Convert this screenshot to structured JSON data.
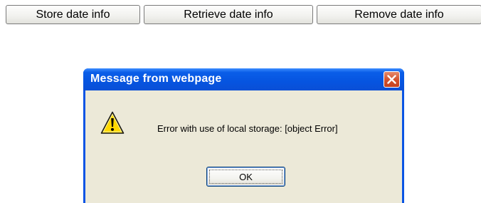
{
  "toolbar": {
    "store_label": "Store date info",
    "retrieve_label": "Retrieve date info",
    "remove_label": "Remove date info"
  },
  "dialog": {
    "title": "Message from webpage",
    "message": "Error with use of local storage: [object Error]",
    "ok_label": "OK",
    "icon": "warning-icon",
    "close_icon": "close-icon"
  },
  "colors": {
    "titlebar": "#0a54e4",
    "close_button": "#d4532e",
    "dialog_body": "#ece9d8",
    "warning_yellow": "#ffd800"
  }
}
